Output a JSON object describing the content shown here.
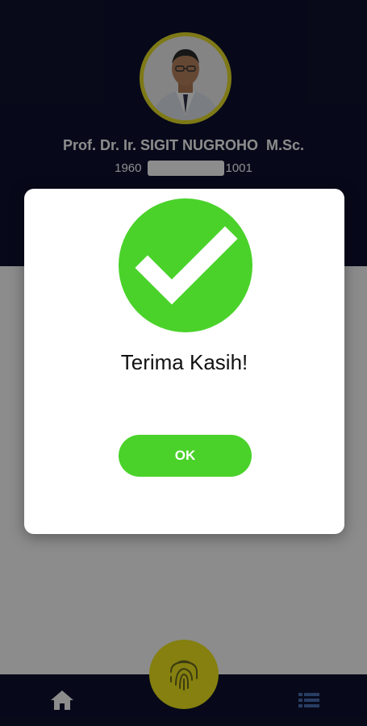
{
  "profile": {
    "name": "Prof. Dr. Ir. SIGIT NUGROHO  M.Sc.",
    "id_prefix": "1960",
    "id_suffix": "1001",
    "ring_color": "#e6dd2a"
  },
  "dialog": {
    "title": "Terima Kasih!",
    "ok_label": "OK",
    "icon": "check-circle-icon",
    "accent_color": "#4ad22a"
  },
  "bottom_nav": {
    "left_icon": "home-icon",
    "center_icon": "fingerprint-icon",
    "right_icon": "list-icon",
    "bar_color": "#0e1230",
    "fab_color": "#f2ea1d"
  }
}
